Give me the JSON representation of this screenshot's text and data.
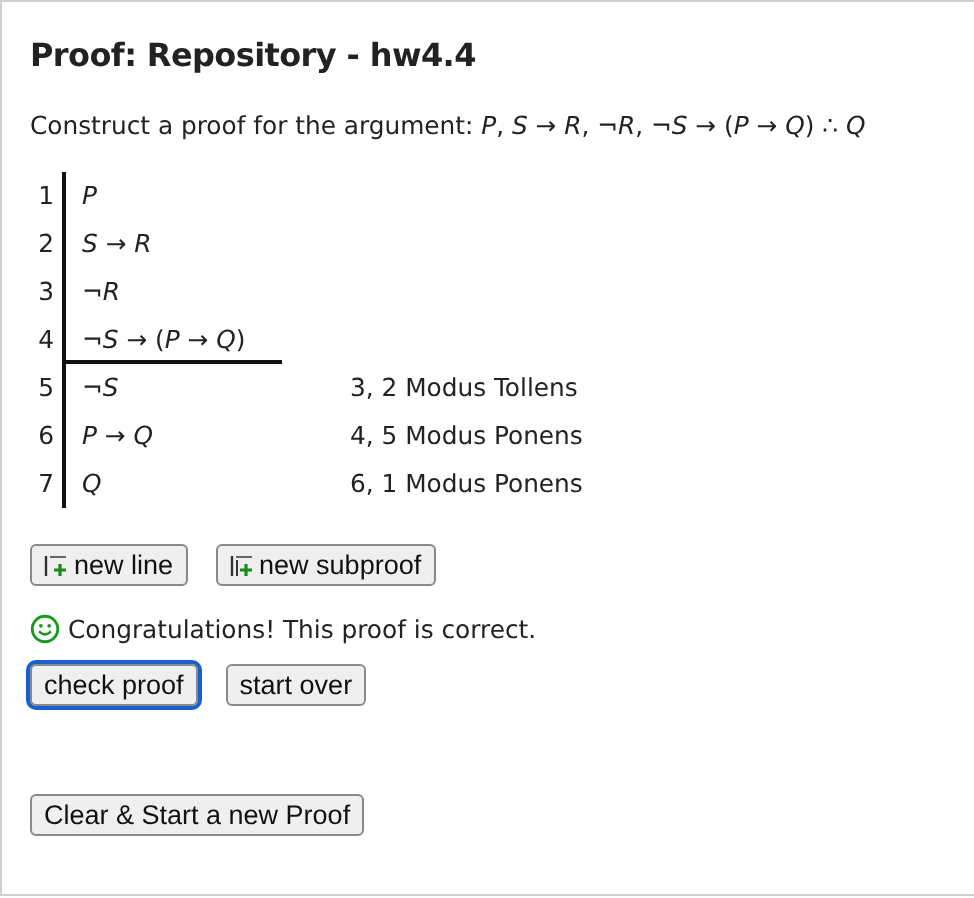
{
  "title": "Proof: Repository - hw4.4",
  "argument": "Construct a proof for the argument: *P*, *S* → *R*, ¬*R*, ¬*S* → (*P* → *Q*) ∴ *Q*",
  "lines": [
    {
      "number": "1",
      "formula": "*P*",
      "kind": "premise"
    },
    {
      "number": "2",
      "formula": "*S* → *R*",
      "kind": "premise"
    },
    {
      "number": "3",
      "formula": "¬*R*",
      "kind": "premise"
    },
    {
      "number": "4",
      "formula": "¬*S* → (*P* → *Q*)",
      "kind": "premise"
    },
    {
      "number": "5",
      "formula": "¬*S*",
      "kind": "derived",
      "justification": "3, 2 Modus Tollens"
    },
    {
      "number": "6",
      "formula": "*P* → *Q*",
      "kind": "derived",
      "justification": "4, 5 Modus Ponens"
    },
    {
      "number": "7",
      "formula": "*Q*",
      "kind": "derived",
      "justification": "6, 1 Modus Ponens"
    }
  ],
  "edit_buttons": [
    {
      "label": "new line",
      "kind": "line"
    },
    {
      "label": "new subproof",
      "kind": "subproof"
    }
  ],
  "result": {
    "message": "Congratulations! This proof is correct.",
    "correct": true
  },
  "check_buttons": [
    {
      "label": "check proof",
      "focused": true
    },
    {
      "label": "start over",
      "focused": false
    }
  ],
  "clear_button": "Clear & Start a new Proof"
}
